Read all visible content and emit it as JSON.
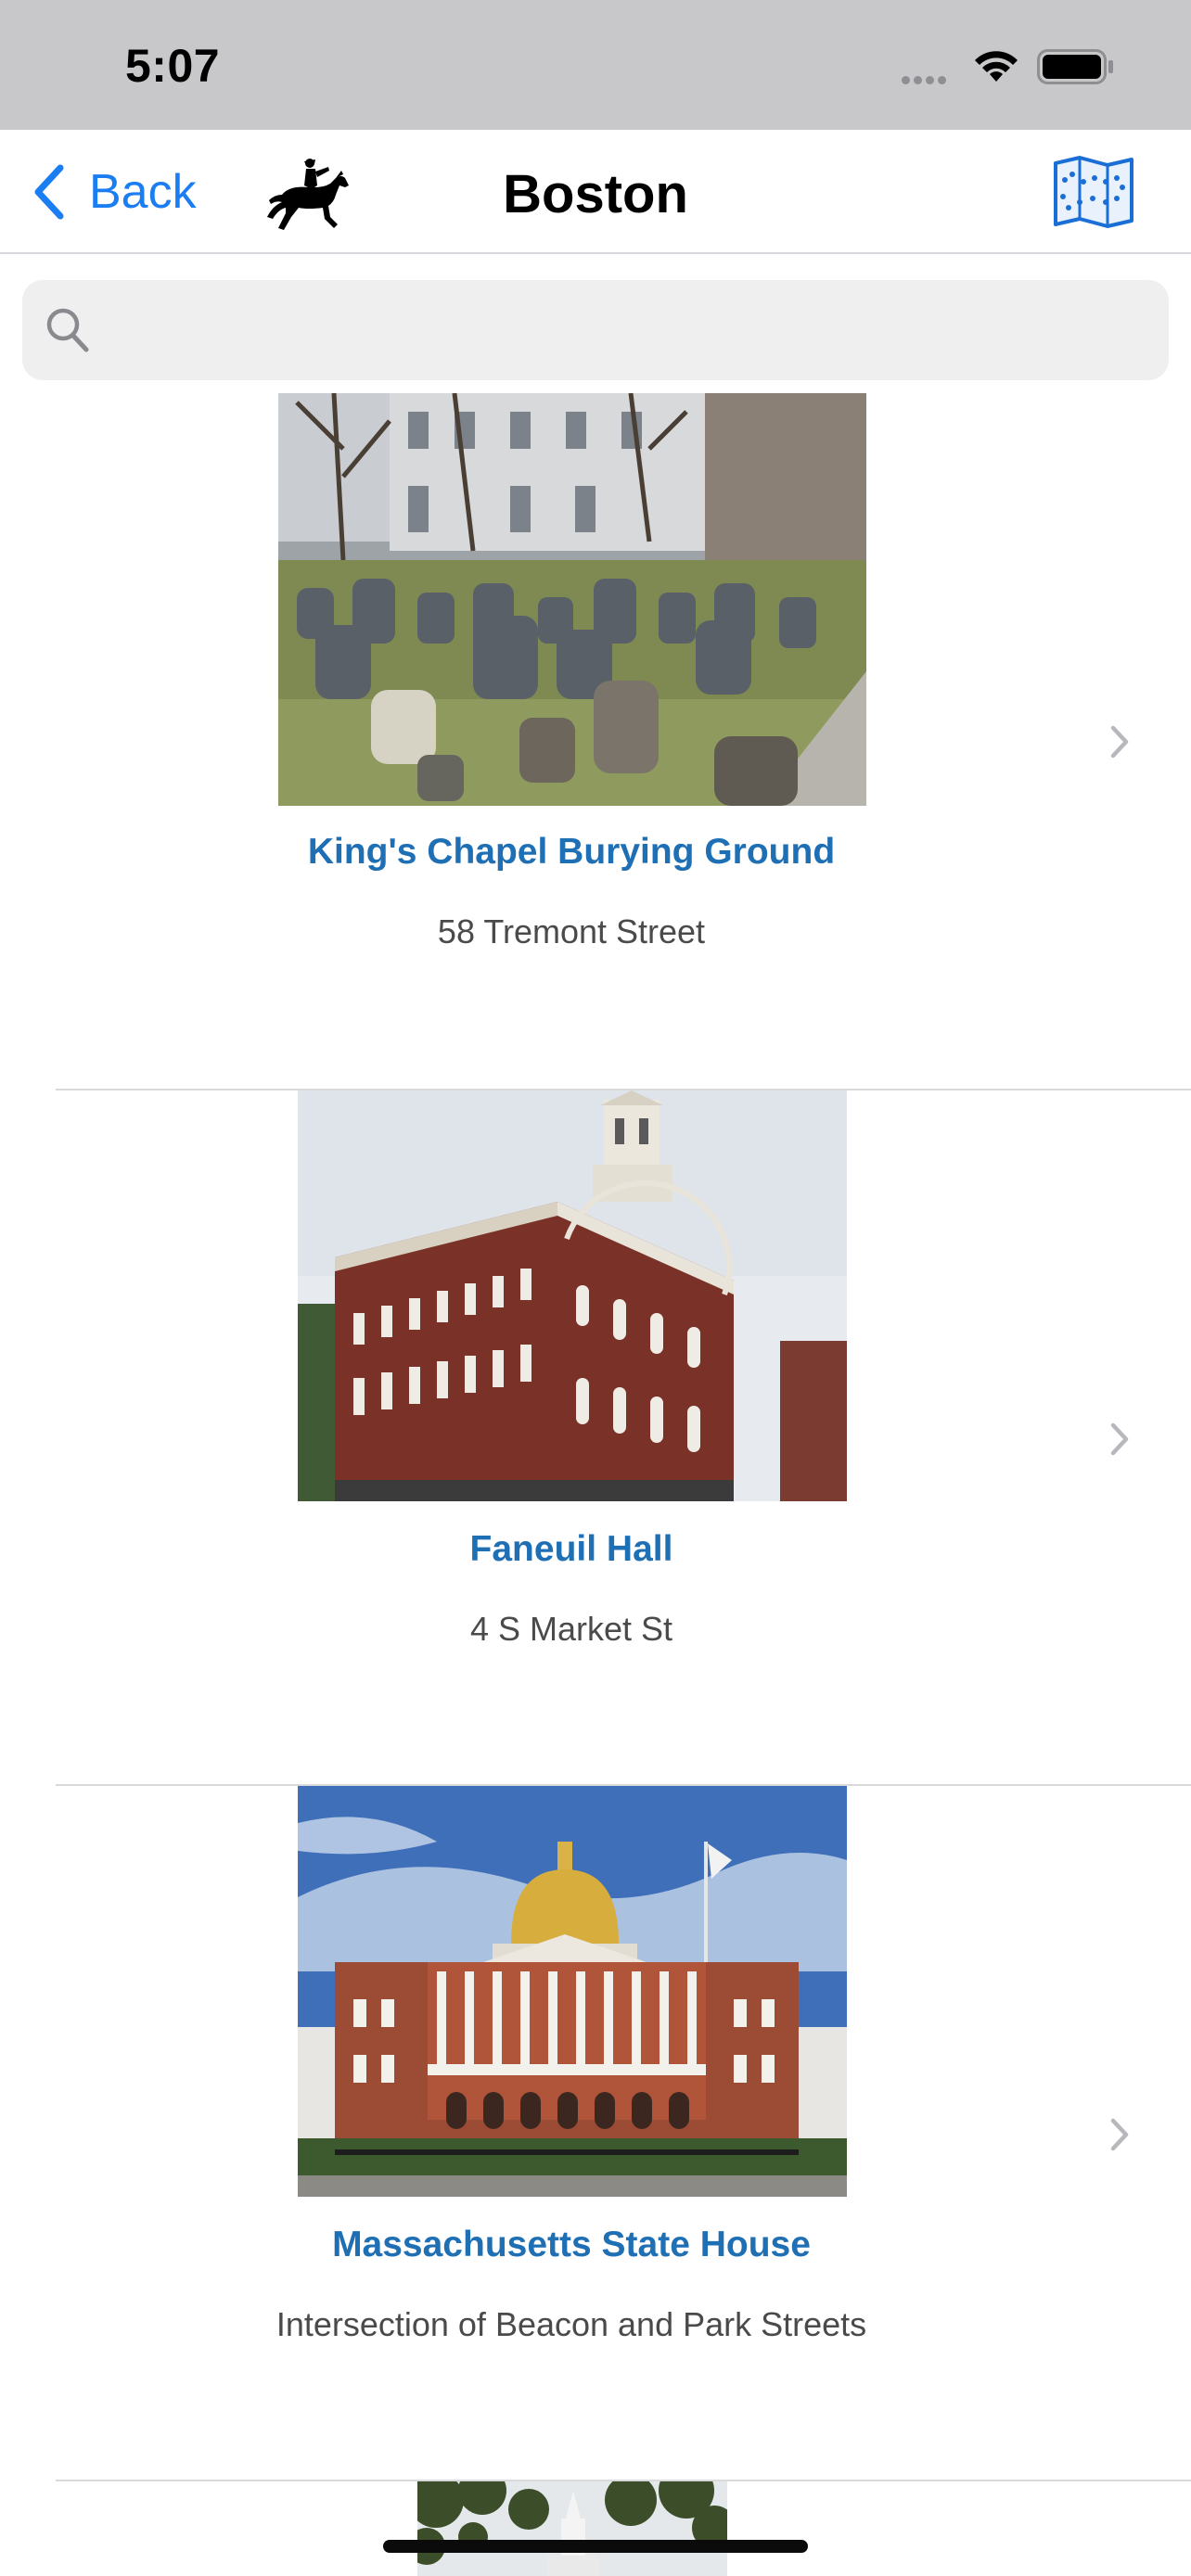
{
  "status_bar": {
    "time": "5:07"
  },
  "nav": {
    "back_label": "Back",
    "title": "Boston"
  },
  "search": {
    "placeholder": "",
    "value": ""
  },
  "places": [
    {
      "name": "King's Chapel Burying Ground",
      "address": "58 Tremont Street"
    },
    {
      "name": "Faneuil Hall",
      "address": "4 S Market St"
    },
    {
      "name": "Massachusetts State House",
      "address": "Intersection of Beacon and Park Streets"
    }
  ],
  "colors": {
    "accent": "#1a7df2",
    "place_title": "#1f6fb5",
    "address": "#4a4a4a",
    "status_bar_bg": "#c8c8ca"
  },
  "icons": {
    "back": "chevron-left-icon",
    "logo": "horse-rider-icon",
    "map": "map-route-icon",
    "search": "search-icon",
    "row_disclosure": "chevron-right-icon"
  }
}
